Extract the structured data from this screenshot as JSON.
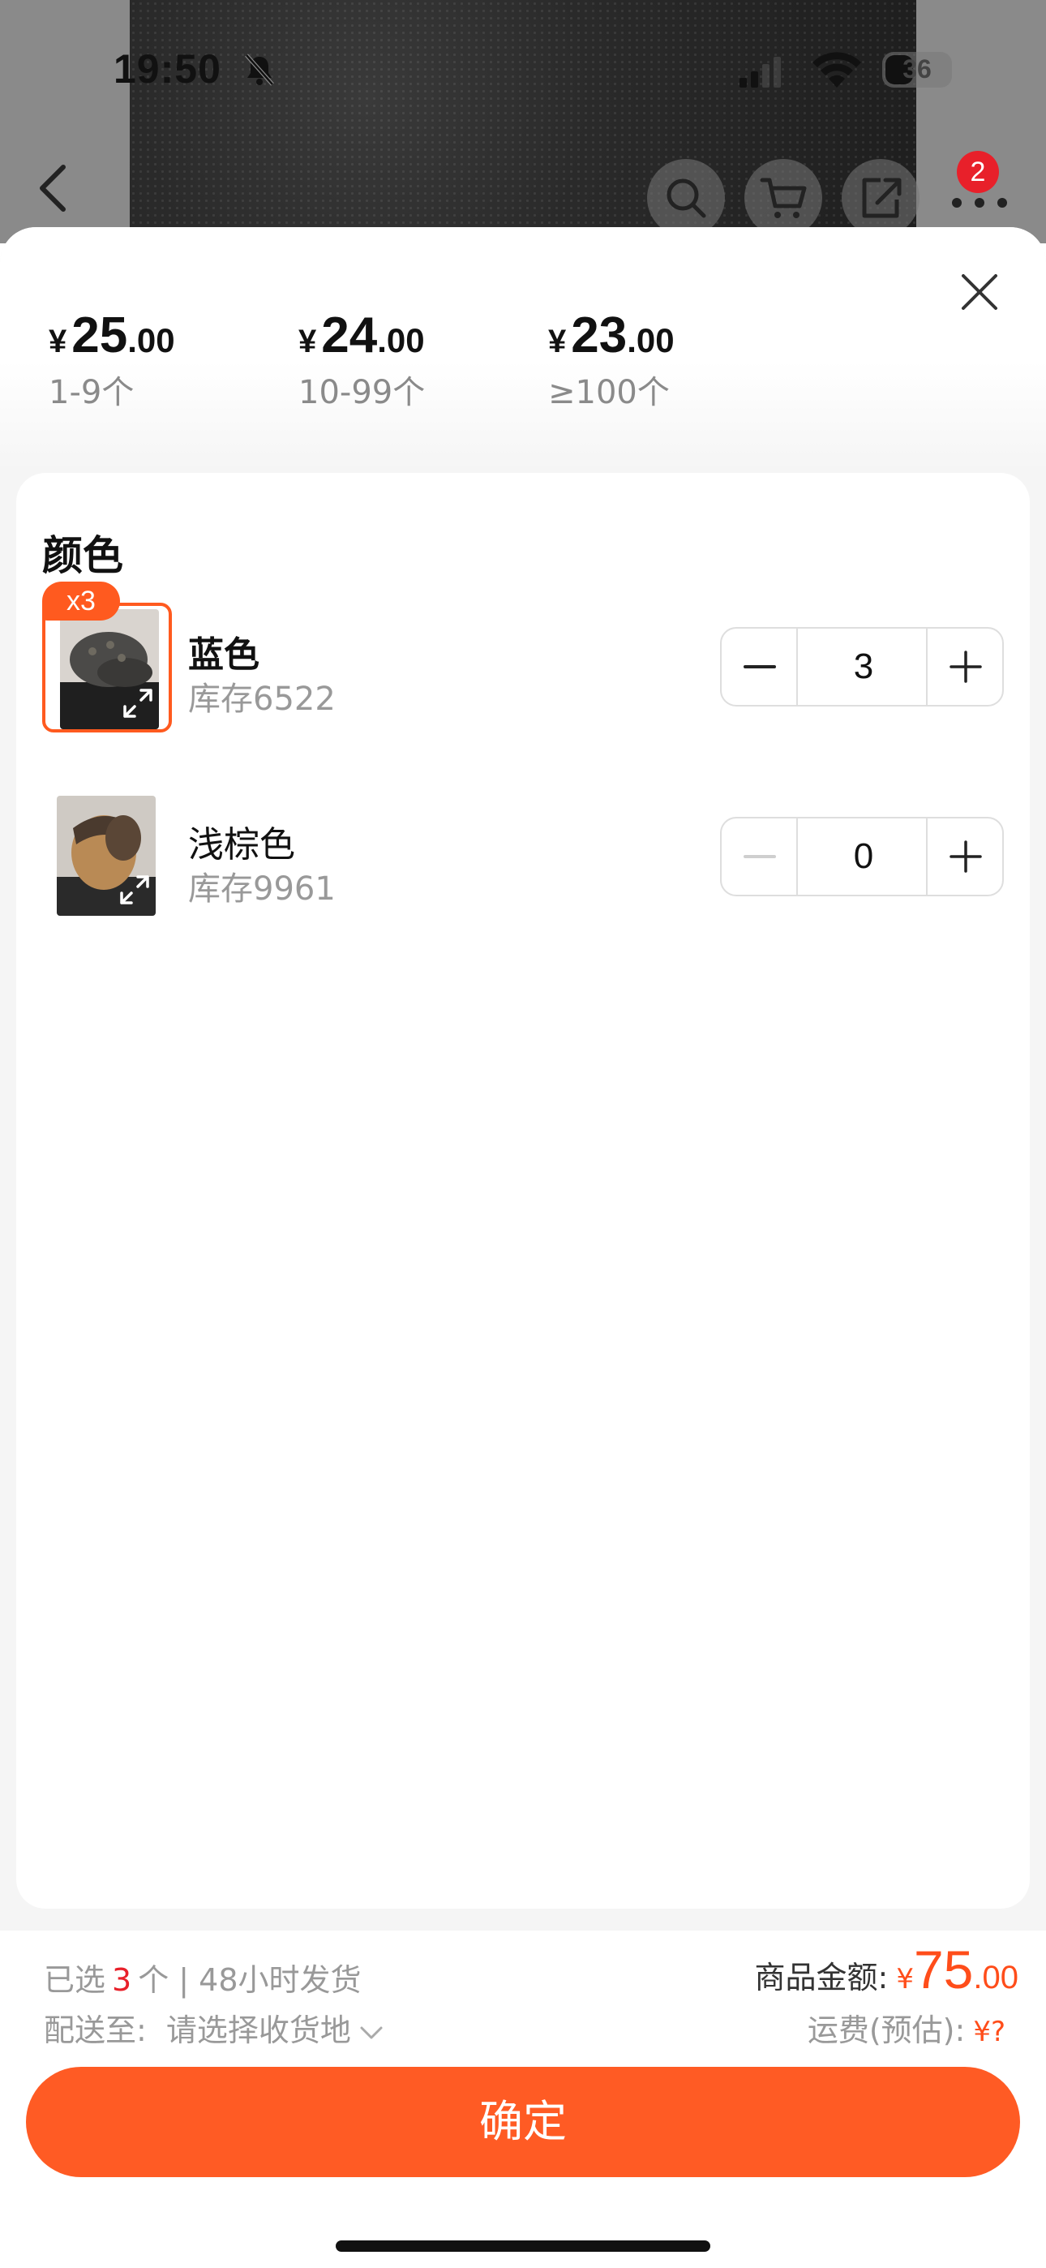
{
  "status_bar": {
    "time": "19:50",
    "battery": "36",
    "icons": [
      "bell-slash-icon",
      "cellular-signal-icon",
      "wifi-icon",
      "battery-icon"
    ]
  },
  "nav": {
    "icons": [
      "back-icon",
      "search-icon",
      "cart-icon",
      "share-icon",
      "more-icon"
    ],
    "badge": "2"
  },
  "price_tiers": [
    {
      "yen": "¥",
      "integer": "25",
      "decimal": ".00",
      "range": "1-9个"
    },
    {
      "yen": "¥",
      "integer": "24",
      "decimal": ".00",
      "range": "10-99个"
    },
    {
      "yen": "¥",
      "integer": "23",
      "decimal": ".00",
      "range": "≥100个"
    }
  ],
  "section": {
    "title": "颜色"
  },
  "options": [
    {
      "name": "蓝色",
      "stock": "库存6522",
      "quantity": "3",
      "badge": "x3",
      "selected": true
    },
    {
      "name": "浅棕色",
      "stock": "库存9961",
      "quantity": "0",
      "selected": false
    }
  ],
  "summary": {
    "selected_prefix": "已选",
    "selected_count": "3",
    "selected_suffix": "个 | 48小时发货",
    "ship_to_label": "配送至:",
    "ship_to_value": "请选择收货地",
    "amount_label": "商品金额:",
    "amount_yen": "¥",
    "amount_integer": "75",
    "amount_decimal": ".00",
    "shipping_label": "运费(预估):",
    "shipping_value": "¥?"
  },
  "confirm_label": "确定",
  "colors": {
    "accent": "#ff5b24",
    "badge": "#e8202a",
    "muted": "#999999"
  }
}
